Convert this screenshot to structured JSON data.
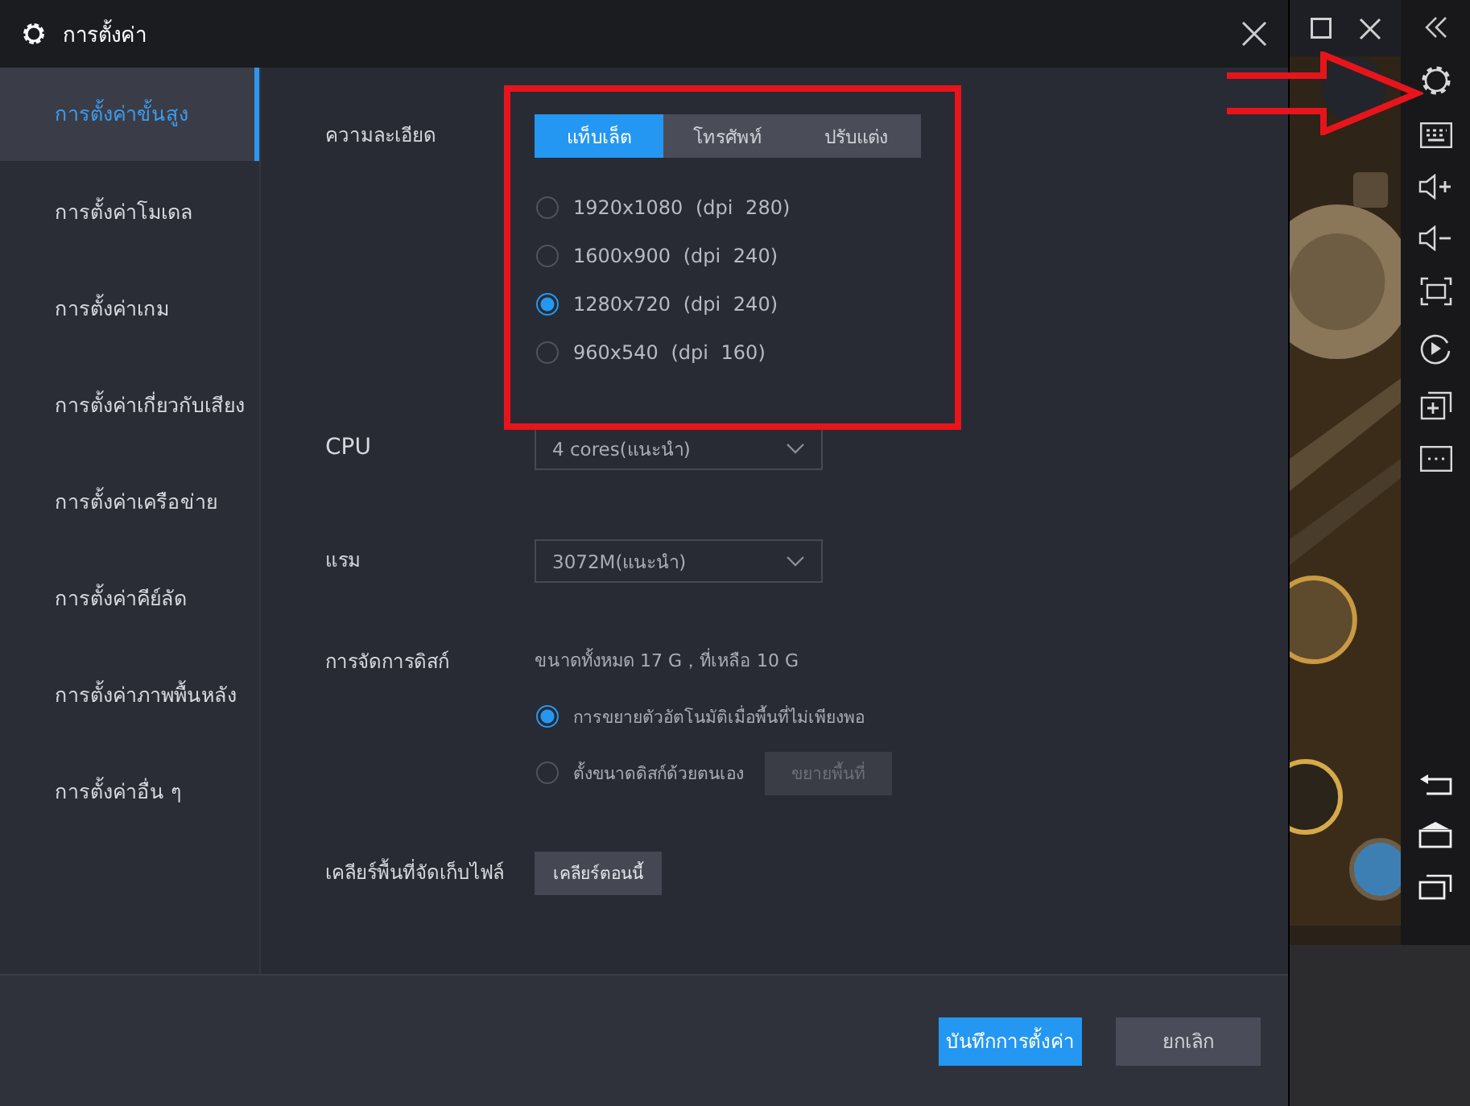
{
  "window": {
    "title": "การตั้งค่า"
  },
  "sidebar": {
    "items": [
      {
        "label": "การตั้งค่าขั้นสูง",
        "selected": true
      },
      {
        "label": "การตั้งค่าโมเดล",
        "selected": false
      },
      {
        "label": "การตั้งค่าเกม",
        "selected": false
      },
      {
        "label": "การตั้งค่าเกี่ยวกับเสียง",
        "selected": false
      },
      {
        "label": "การตั้งค่าเครือข่าย",
        "selected": false
      },
      {
        "label": "การตั้งค่าคีย์ลัด",
        "selected": false
      },
      {
        "label": "การตั้งค่าภาพพื้นหลัง",
        "selected": false
      },
      {
        "label": "การตั้งค่าอื่น ๆ",
        "selected": false
      }
    ]
  },
  "resolution": {
    "label": "ความละเอียด",
    "tabs": [
      {
        "label": "แท็บเล็ต",
        "selected": true
      },
      {
        "label": "โทรศัพท์",
        "selected": false
      },
      {
        "label": "ปรับแต่ง",
        "selected": false
      }
    ],
    "options": [
      {
        "label": "1920x1080 (dpi 280)",
        "selected": false
      },
      {
        "label": "1600x900 (dpi 240)",
        "selected": false
      },
      {
        "label": "1280x720 (dpi 240)",
        "selected": true
      },
      {
        "label": "960x540 (dpi 160)",
        "selected": false
      }
    ]
  },
  "cpu": {
    "label": "CPU",
    "value": "4 cores(แนะนำ)"
  },
  "ram": {
    "label": "แรม",
    "value": "3072M(แนะนำ)"
  },
  "disk": {
    "label": "การจัดการดิสก์",
    "summary": "ขนาดทั้งหมด 17 G，ที่เหลือ 10 G",
    "options": [
      {
        "label": "การขยายตัวอัตโนมัติเมื่อพื้นที่ไม่เพียงพอ",
        "selected": true
      },
      {
        "label": "ตั้งขนาดดิสก์ด้วยตนเอง",
        "selected": false
      }
    ],
    "expand_button": {
      "label": "ขยายพื้นที่",
      "disabled": true
    }
  },
  "clear": {
    "label": "เคลียร์พื้นที่จัดเก็บไฟล์",
    "button": "เคลียร์ตอนนี้"
  },
  "buttons": [
    {
      "label": "บันทึกการตั้งค่า",
      "kind": "primary"
    },
    {
      "label": "ยกเลิก",
      "kind": "secondary"
    }
  ]
}
